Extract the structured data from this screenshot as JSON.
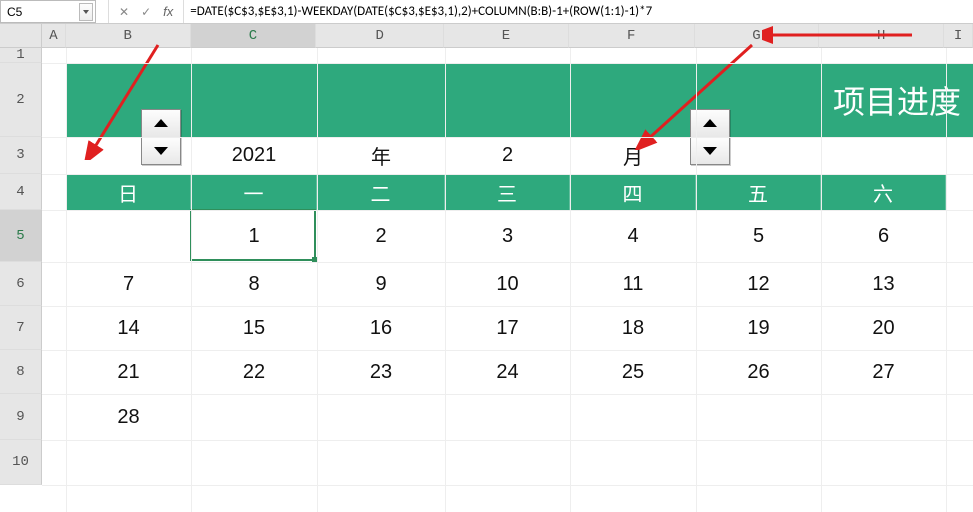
{
  "formula_bar": {
    "cell_ref": "C5",
    "formula": "=DATE($C$3,$E$3,1)-WEEKDAY(DATE($C$3,$E$3,1),2)+COLUMN(B:B)-1+(ROW(1:1)-1)*7"
  },
  "columns": {
    "letters": [
      "A",
      "B",
      "C",
      "D",
      "E",
      "F",
      "G",
      "H",
      "I"
    ],
    "widths": [
      24,
      125,
      126,
      128,
      125,
      126,
      125,
      125,
      29
    ],
    "selected": "C"
  },
  "rows": {
    "numbers": [
      "1",
      "2",
      "3",
      "4",
      "5",
      "6",
      "7",
      "8",
      "9",
      "10"
    ],
    "heights": [
      15,
      74,
      37,
      36,
      52,
      44,
      44,
      44,
      46,
      45
    ],
    "selected": "5"
  },
  "banner": {
    "title": "项目进度"
  },
  "row3": {
    "year": "2021",
    "year_suffix": "年",
    "month": "2",
    "month_suffix": "月"
  },
  "week_headers": [
    "日",
    "一",
    "二",
    "三",
    "四",
    "五",
    "六"
  ],
  "calendar": [
    [
      "",
      "1",
      "2",
      "3",
      "4",
      "5",
      "6"
    ],
    [
      "7",
      "8",
      "9",
      "10",
      "11",
      "12",
      "13"
    ],
    [
      "14",
      "15",
      "16",
      "17",
      "18",
      "19",
      "20"
    ],
    [
      "21",
      "22",
      "23",
      "24",
      "25",
      "26",
      "27"
    ],
    [
      "28",
      "",
      "",
      "",
      "",
      "",
      ""
    ]
  ],
  "colors": {
    "accent": "#2ea97d"
  }
}
